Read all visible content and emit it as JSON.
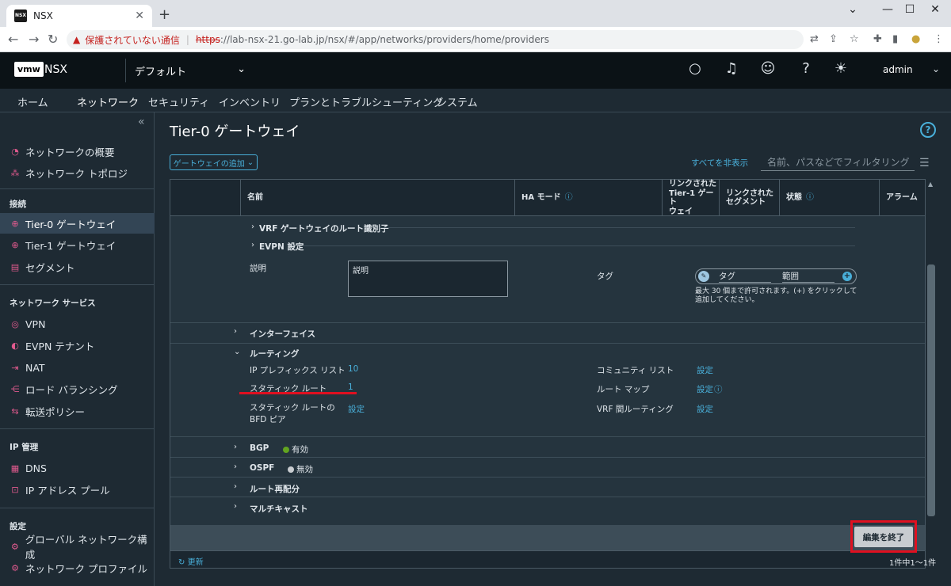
{
  "browser": {
    "tab_title": "NSX",
    "favicon_text": "NSX",
    "security_label": "保護されていない通信",
    "url_scheme": "https",
    "url_rest": "://lab-nsx-21.go-lab.jp/nsx/#/app/networks/providers/home/providers"
  },
  "header": {
    "logo": "vmw",
    "product": "NSX",
    "context": "デフォルト",
    "user": "admin"
  },
  "topnav": [
    "ホーム",
    "ネットワーク",
    "セキュリティ",
    "インベントリ",
    "プランとトラブルシューティング",
    "システム"
  ],
  "sidebar": {
    "items_top": [
      {
        "label": "ネットワークの概要",
        "icon": "gauge-icon"
      },
      {
        "label": "ネットワーク トポロジ",
        "icon": "topology-icon"
      }
    ],
    "section_connectivity": "接続",
    "items_connectivity": [
      {
        "label": "Tier-0 ゲートウェイ",
        "icon": "globe-icon"
      },
      {
        "label": "Tier-1 ゲートウェイ",
        "icon": "globe-icon"
      },
      {
        "label": "セグメント",
        "icon": "segment-icon"
      }
    ],
    "section_services": "ネットワーク サービス",
    "items_services": [
      {
        "label": "VPN",
        "icon": "vpn-icon"
      },
      {
        "label": "EVPN テナント",
        "icon": "evpn-icon"
      },
      {
        "label": "NAT",
        "icon": "nat-icon"
      },
      {
        "label": "ロード バランシング",
        "icon": "loadbalancer-icon"
      },
      {
        "label": "転送ポリシー",
        "icon": "forwarding-icon"
      }
    ],
    "section_ip": "IP 管理",
    "items_ip": [
      {
        "label": "DNS",
        "icon": "dns-icon"
      },
      {
        "label": "IP アドレス プール",
        "icon": "ip-pool-icon"
      }
    ],
    "section_settings": "設定",
    "items_settings": [
      {
        "label": "グローバル ネットワーク構成",
        "icon": "global-config-icon"
      },
      {
        "label": "ネットワーク プロファイル",
        "icon": "profile-icon"
      }
    ]
  },
  "main": {
    "title": "Tier-0 ゲートウェイ",
    "add_button": "ゲートウェイの追加",
    "hide_all": "すべてを非表示",
    "filter_placeholder": "名前、パスなどでフィルタリング",
    "columns": {
      "name": "名前",
      "ha_mode": "HA モード",
      "linked_t1_line1": "リンクされた",
      "linked_t1_line2": "Tier-1 ゲート",
      "linked_t1_line3": "ウェイ",
      "linked_seg_line1": "リンクされた",
      "linked_seg_line2": "セグメント",
      "status": "状態",
      "alarm": "アラーム"
    },
    "vrf_route_distinguisher": "VRF ゲートウェイのルート識別子",
    "evpn_settings": "EVPN 設定",
    "description_label": "説明",
    "description_placeholder": "説明",
    "tag_label": "タグ",
    "tag_placeholder": "タグ",
    "scope_placeholder": "範囲",
    "tag_hint": "最大 30 個まで許可されます。(+) をクリックして追加してください。",
    "interfaces": "インターフェイス",
    "routing": "ルーティング",
    "ip_prefix_list_label": "IP プレフィックス リスト",
    "ip_prefix_list_value": "10",
    "static_routes_label": "スタティック ルート",
    "static_routes_value": "1",
    "bfd_label_line1": "スタティック ルートの",
    "bfd_label_line2": "BFD ピア",
    "bfd_value": "設定",
    "community_list_label": "コミュニティ リスト",
    "community_list_value": "設定",
    "route_map_label": "ルート マップ",
    "route_map_value": "設定",
    "vrf_routing_label": "VRF 間ルーティング",
    "vrf_routing_value": "設定",
    "bgp": "BGP",
    "bgp_status": "有効",
    "ospf": "OSPF",
    "ospf_status": "無効",
    "route_redistribution": "ルート再配分",
    "multicast": "マルチキャスト",
    "finish_editing": "編集を終了",
    "refresh": "更新",
    "page_count": "1件中1～1件",
    "colors": {
      "accent": "#49afd9",
      "enabled": "#62a420",
      "disabled": "#c8ccd0",
      "highlight": "#e01020"
    }
  }
}
